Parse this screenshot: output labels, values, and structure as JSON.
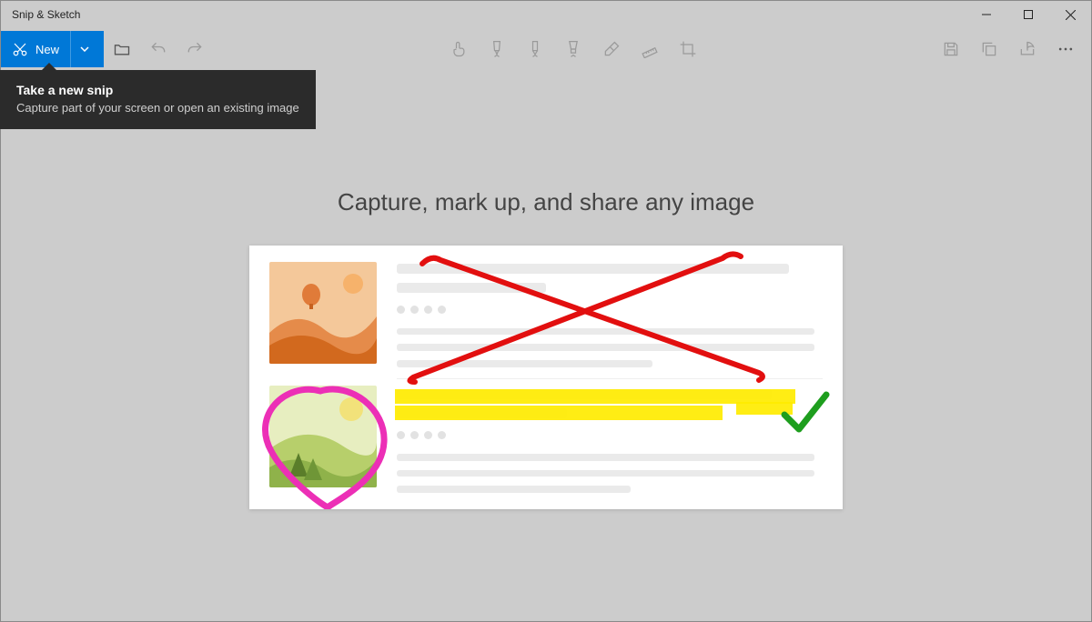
{
  "window": {
    "title": "Snip & Sketch"
  },
  "toolbar": {
    "new_label": "New",
    "icons": {
      "new": "snip-icon",
      "open": "open-icon",
      "undo": "undo-icon",
      "redo": "redo-icon",
      "touch": "touch-write-icon",
      "ballpoint": "ballpoint-pen-icon",
      "pencil": "pencil-icon",
      "highlighter": "highlighter-icon",
      "eraser": "eraser-icon",
      "ruler": "ruler-icon",
      "crop": "crop-icon",
      "save": "save-icon",
      "copy": "copy-icon",
      "share": "share-icon",
      "more": "more-icon"
    }
  },
  "tooltip": {
    "title": "Take a new snip",
    "subtitle": "Capture part of your screen or open an existing image"
  },
  "content": {
    "headline": "Capture, mark up, and share any image"
  }
}
